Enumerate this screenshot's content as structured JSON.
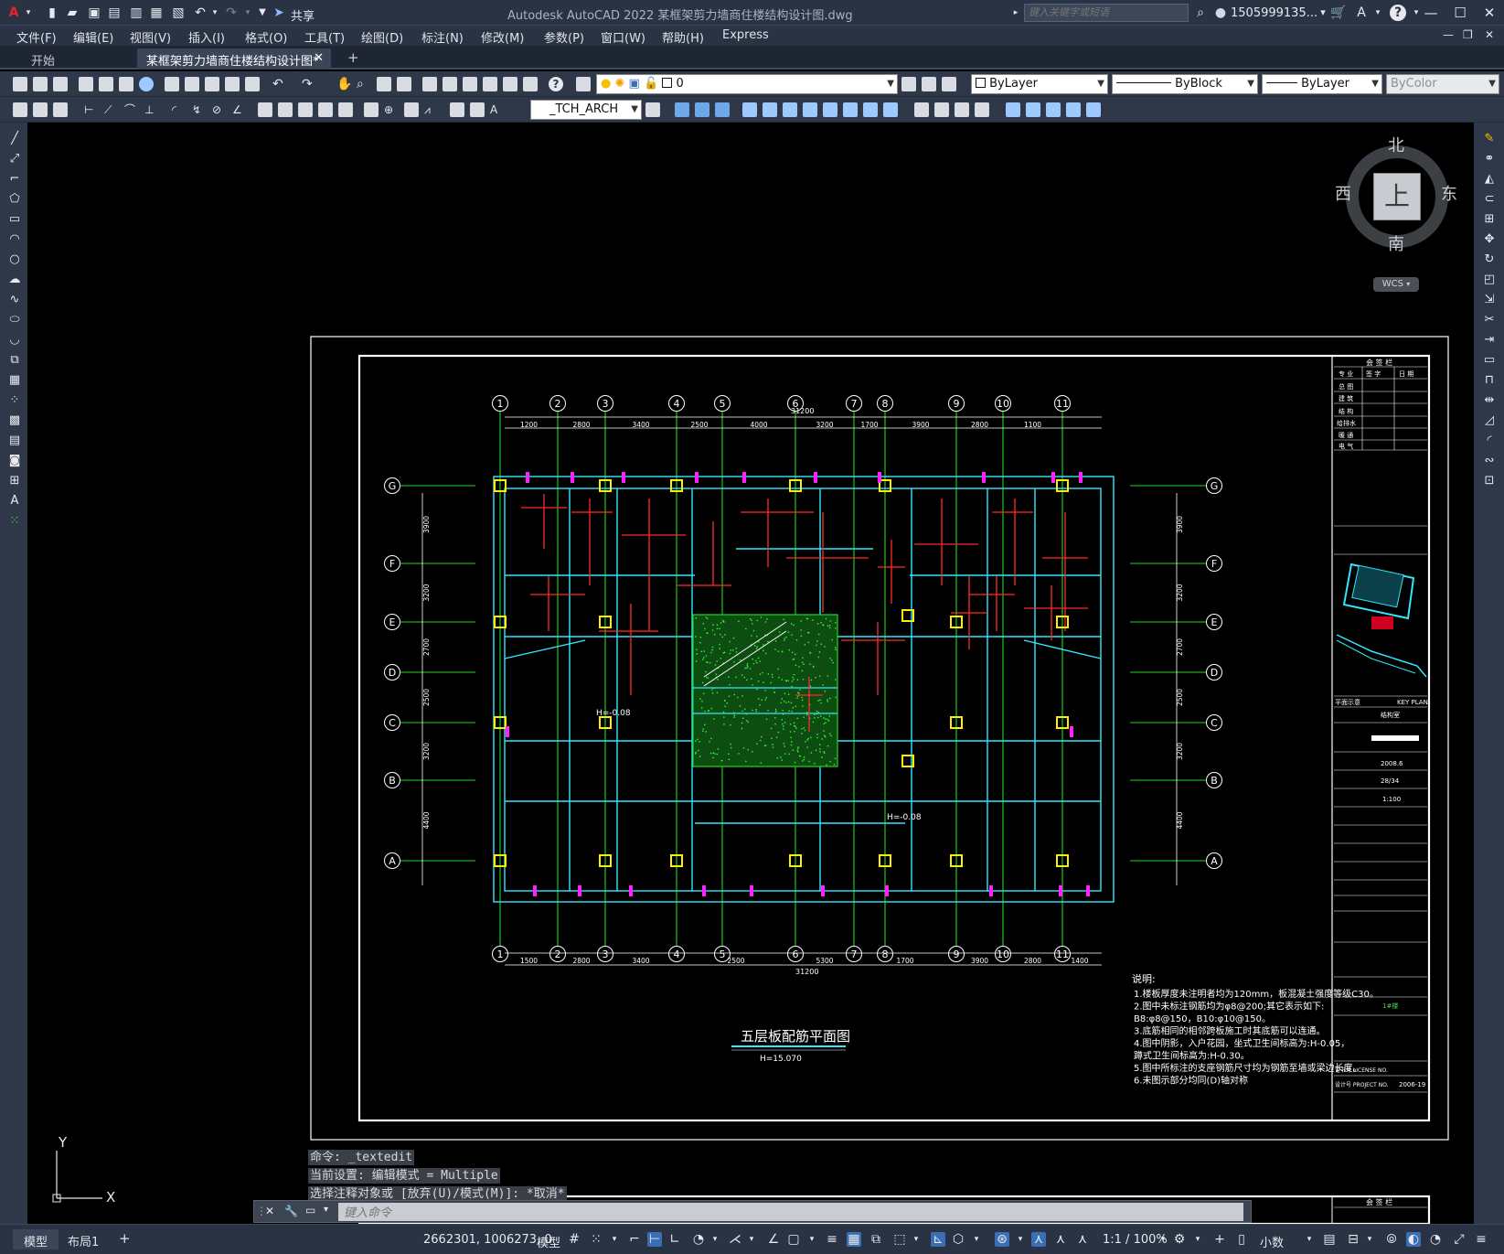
{
  "app": {
    "title": "Autodesk AutoCAD 2022   某框架剪力墙商住楼结构设计图.dwg",
    "share_label": "共享",
    "search_placeholder": "键入关键字或短语",
    "user": "1505999135...",
    "help_icon": "question-icon"
  },
  "menu": [
    "文件(F)",
    "编辑(E)",
    "视图(V)",
    "插入(I)",
    "格式(O)",
    "工具(T)",
    "绘图(D)",
    "标注(N)",
    "修改(M)",
    "参数(P)",
    "窗口(W)",
    "帮助(H)",
    "Express"
  ],
  "tabs": {
    "start": "开始",
    "drawing": "某框架剪力墙商住楼结构设计图*"
  },
  "toolbar": {
    "layer_value": "0",
    "color": "ByLayer",
    "linetype": "ByBlock",
    "lineweight": "ByLayer",
    "plotstyle": "ByColor",
    "textstyle": "_TCH_ARCH"
  },
  "viewcube": {
    "north": "北",
    "south": "南",
    "east": "东",
    "west": "西",
    "top": "上",
    "wcs": "WCS"
  },
  "drawing": {
    "axes_top": [
      "1",
      "2",
      "3",
      "4",
      "5",
      "6",
      "7",
      "8",
      "9",
      "10",
      "11"
    ],
    "axes_side": [
      "G",
      "F",
      "E",
      "D",
      "C",
      "B",
      "A"
    ],
    "total_dim": "31200",
    "top_dims": [
      "1200",
      "2800",
      "3400",
      "2500",
      "4000",
      "3200",
      "1700",
      "3900",
      "2800",
      "1100"
    ],
    "bottom_dims": [
      "1500",
      "2800",
      "3400",
      "2500",
      "5300",
      "1700",
      "3900",
      "2800",
      "1400"
    ],
    "plan_title": "五层板配筋平面图",
    "plan_elev": "H=15.070",
    "elev_marks": [
      "H=-0.08",
      "H=-0.08"
    ],
    "left_dims": [
      "3900",
      "3200",
      "2700",
      "2500",
      "3200",
      "4400"
    ],
    "notes_title": "说明:",
    "notes": [
      "1.楼板厚度未注明者均为120mm，板混凝土强度等级C30。",
      "2.图中未标注钢筋均为φ8@200;其它表示如下:",
      "  B8:φ8@150，B10:φ10@150。",
      "3.底筋相同的相邻跨板施工时其底筋可以连通。",
      "4.图中阴影，入户花园，坐式卫生间标高为:H-0.05，",
      "  蹲式卫生间标高为:H-0.30。",
      "5.图中所标注的支座钢筋尺寸均为钢筋至墙或梁边长度。",
      "6.未图示部分均同(D)轴对称"
    ],
    "title_block": {
      "countersign": "会 签 栏",
      "roles": [
        "专 业",
        "签 字",
        "日 期"
      ],
      "disciplines": [
        "总 图",
        "建 筑",
        "结 构",
        "给排水",
        "暖 通",
        "电 气"
      ],
      "key_plan": "KEY PLAN",
      "key_plan_cn": "平面示意",
      "dept": "结构室",
      "date": "2008.6",
      "dwg_no": "28/34",
      "scale": "1:100",
      "sub_item": "1#楼",
      "project_no": "2006-19",
      "license": "证书号 LICENSE NO.",
      "project_no_label": "设计号 PROJECT NO."
    }
  },
  "command": {
    "history": [
      "命令: _textedit",
      "当前设置: 编辑模式 = Multiple",
      "选择注释对象或 [放弃(U)/模式(M)]: *取消*"
    ],
    "placeholder": "键入命令"
  },
  "status": {
    "model_tab": "模型",
    "layout_tab": "布局1",
    "coords": "2662301, 1006273, 0",
    "model_btn": "模型",
    "scale": "1:1 / 100%",
    "units": "小数"
  },
  "ucs": {
    "y": "Y",
    "x": "X"
  }
}
